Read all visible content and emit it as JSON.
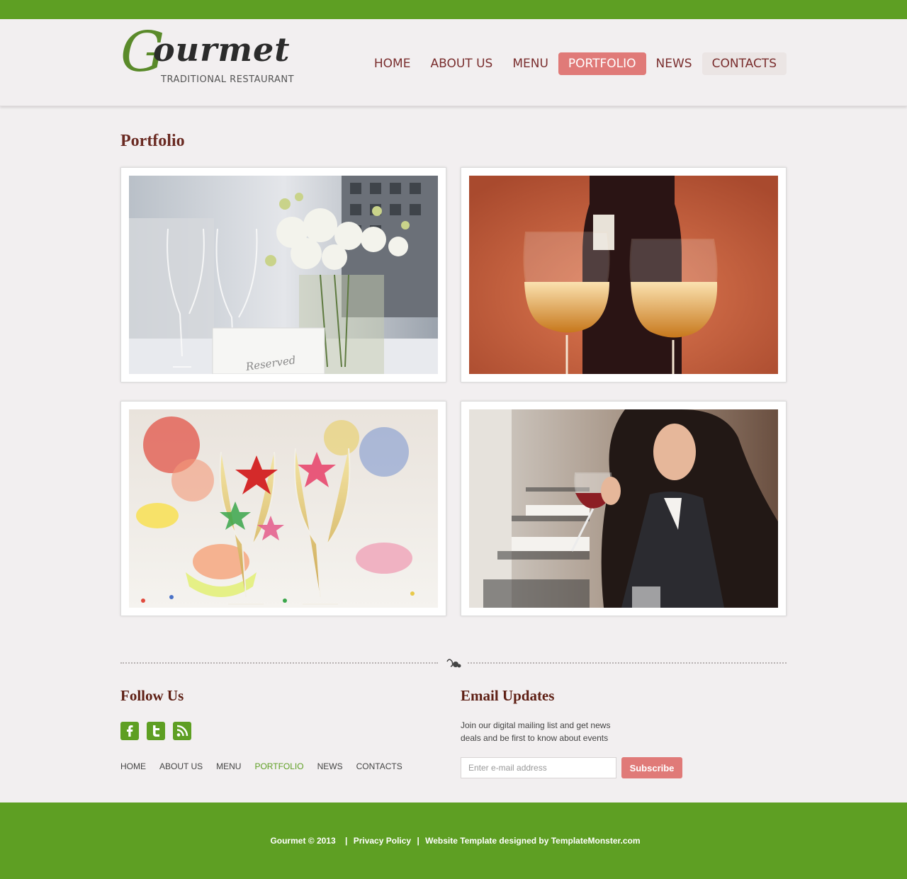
{
  "colors": {
    "brand_green": "#5e9f23",
    "accent_pink": "#e07a78",
    "title_brown": "#6a2a22",
    "nav_text": "#7a2e2e"
  },
  "logo": {
    "initial": "G",
    "word": "ourmet",
    "tagline": "TRADITIONAL RESTAURANT"
  },
  "nav": {
    "items": [
      {
        "label": "HOME"
      },
      {
        "label": "ABOUT US"
      },
      {
        "label": "MENU"
      },
      {
        "label": "PORTFOLIO",
        "active": true
      },
      {
        "label": "NEWS"
      },
      {
        "label": "CONTACTS"
      }
    ]
  },
  "page": {
    "title": "Portfolio"
  },
  "gallery": {
    "items": [
      {
        "subject": "wine glasses with white roses",
        "card_text": "Reserved"
      },
      {
        "subject": "two glasses of white wine with bottle"
      },
      {
        "subject": "champagne glasses with star decorations"
      },
      {
        "subject": "woman holding glass of red wine"
      }
    ]
  },
  "follow": {
    "title": "Follow Us",
    "icons": [
      "facebook-icon",
      "twitter-icon",
      "rss-icon"
    ]
  },
  "footer_nav": {
    "items": [
      {
        "label": "HOME"
      },
      {
        "label": "ABOUT US"
      },
      {
        "label": "MENU"
      },
      {
        "label": "PORTFOLIO",
        "active": true
      },
      {
        "label": "NEWS"
      },
      {
        "label": "CONTACTS"
      }
    ]
  },
  "email": {
    "title": "Email Updates",
    "text": "Join our digital mailing list and get news deals and be first to know about events",
    "placeholder": "Enter e-mail address",
    "button": "Subscribe"
  },
  "footer": {
    "copyright": "Gourmet © 2013",
    "privacy": "Privacy Policy",
    "credit": "Website Template designed by TemplateMonster.com",
    "separator": "|"
  }
}
